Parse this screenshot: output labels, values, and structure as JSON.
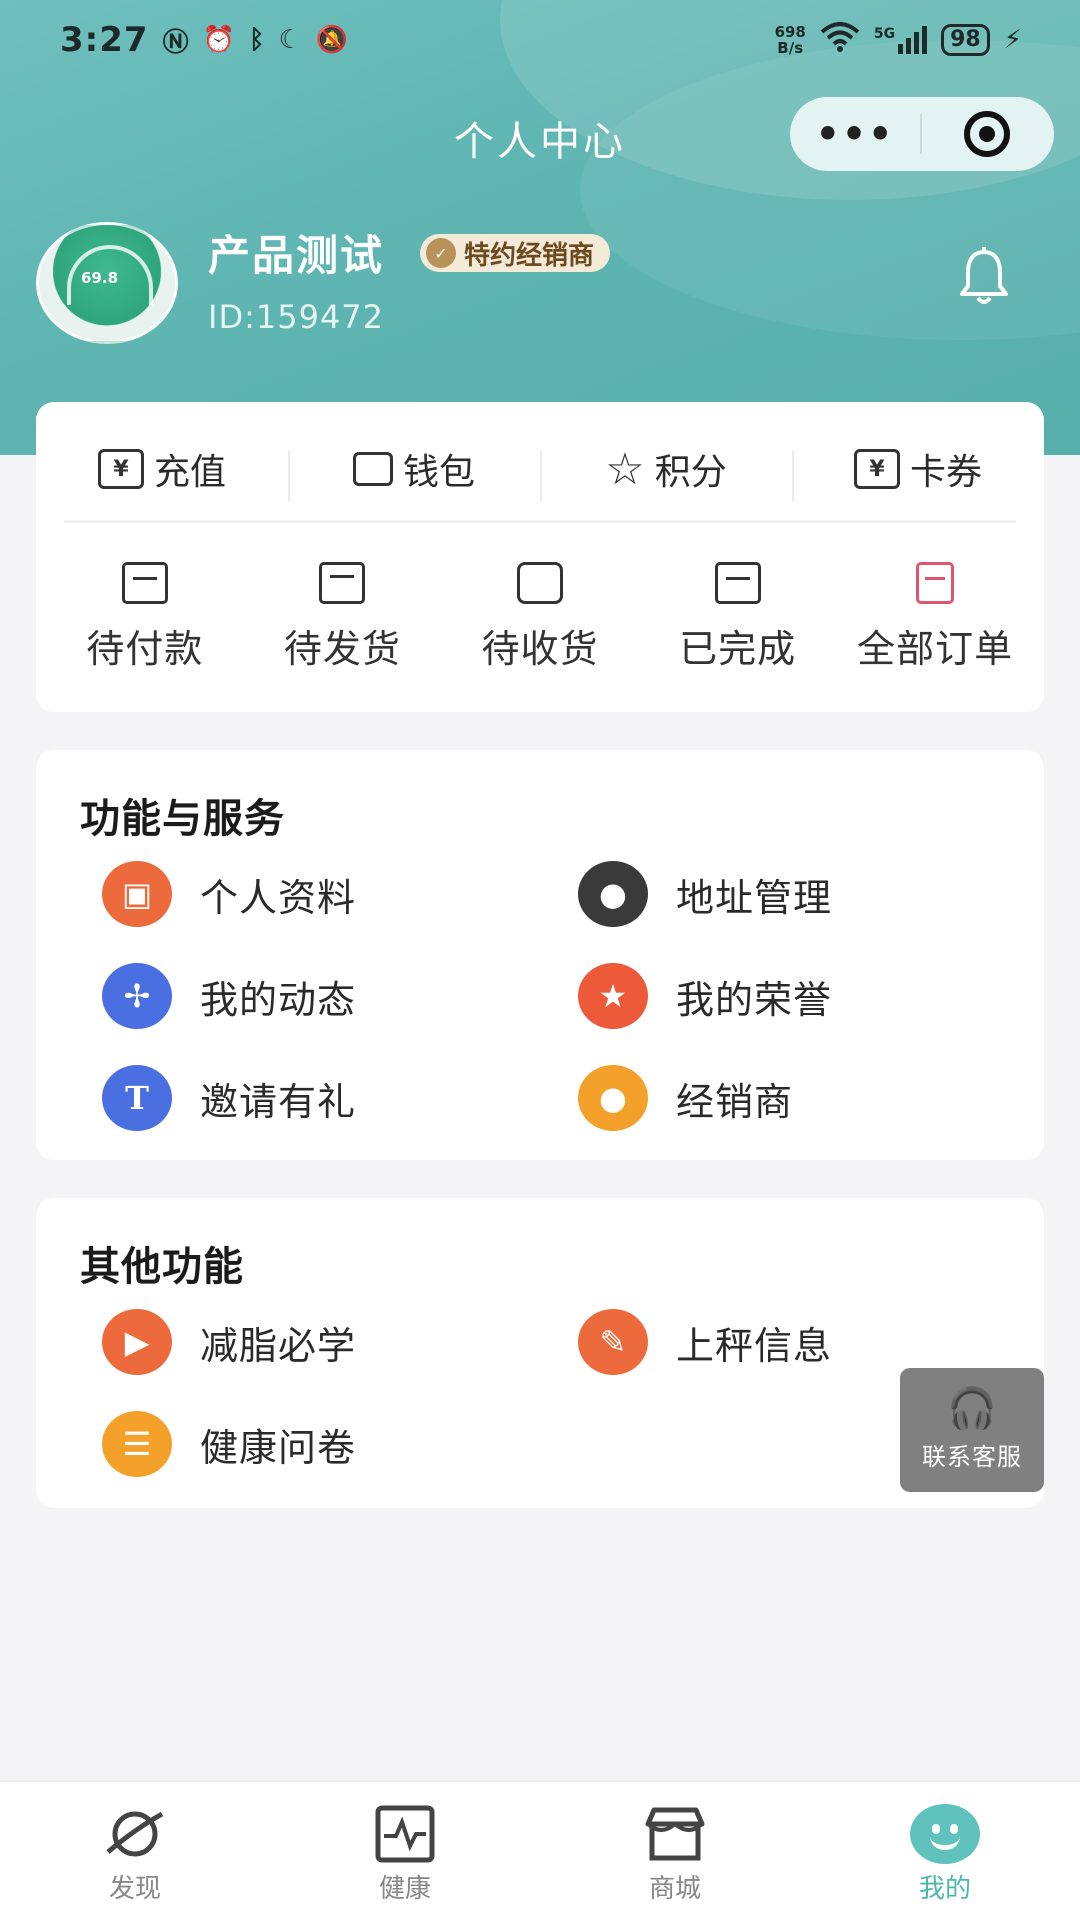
{
  "status_bar": {
    "time": "3:27",
    "network_speed_value": "698",
    "network_speed_unit": "B/s",
    "network_type": "5G",
    "battery": "98"
  },
  "header": {
    "title": "个人中心"
  },
  "profile": {
    "avatar_weight": "69.8",
    "name": "产品测试",
    "badge": "特约经销商",
    "id_text": "ID:159472"
  },
  "assets": [
    {
      "label": "充值",
      "icon": "yuan-icon"
    },
    {
      "label": "钱包",
      "icon": "wallet-icon"
    },
    {
      "label": "积分",
      "icon": "star-outline-icon"
    },
    {
      "label": "卡券",
      "icon": "coupon-icon"
    }
  ],
  "orders": [
    {
      "label": "待付款",
      "icon": "pending-payment-icon"
    },
    {
      "label": "待发货",
      "icon": "box-icon"
    },
    {
      "label": "待收货",
      "icon": "truck-icon"
    },
    {
      "label": "已完成",
      "icon": "message-check-icon"
    },
    {
      "label": "全部订单",
      "icon": "document-icon"
    }
  ],
  "services": {
    "title": "功能与服务",
    "items": [
      {
        "label": "个人资料",
        "icon": "profile-card-icon",
        "color": "#ec6a3c"
      },
      {
        "label": "地址管理",
        "icon": "location-pin-icon",
        "color": "#3a3a3a"
      },
      {
        "label": "我的动态",
        "icon": "pinwheel-icon",
        "color": "#4a6fe0"
      },
      {
        "label": "我的荣誉",
        "icon": "star-badge-icon",
        "color": "#ec5a3a"
      },
      {
        "label": "邀请有礼",
        "icon": "letter-t-icon",
        "color": "#4a6fe0"
      },
      {
        "label": "经销商",
        "icon": "person-icon",
        "color": "#f3a12a"
      }
    ]
  },
  "others": {
    "title": "其他功能",
    "items": [
      {
        "label": "减脂必学",
        "icon": "video-play-icon",
        "color": "#ec6a3c"
      },
      {
        "label": "上秤信息",
        "icon": "edit-note-icon",
        "color": "#ec6a3c"
      },
      {
        "label": "健康问卷",
        "icon": "checklist-icon",
        "color": "#f3a12a"
      }
    ]
  },
  "customer_service": {
    "label": "联系客服"
  },
  "tabbar": [
    {
      "label": "发现",
      "icon": "planet-icon",
      "active": false
    },
    {
      "label": "健康",
      "icon": "heartbeat-icon",
      "active": false
    },
    {
      "label": "商城",
      "icon": "store-icon",
      "active": false
    },
    {
      "label": "我的",
      "icon": "smiley-icon",
      "active": true
    }
  ],
  "colors": {
    "header_teal": "#5eb5b1",
    "accent": "#4fb7b0",
    "badge_bg": "#f3ead8"
  }
}
